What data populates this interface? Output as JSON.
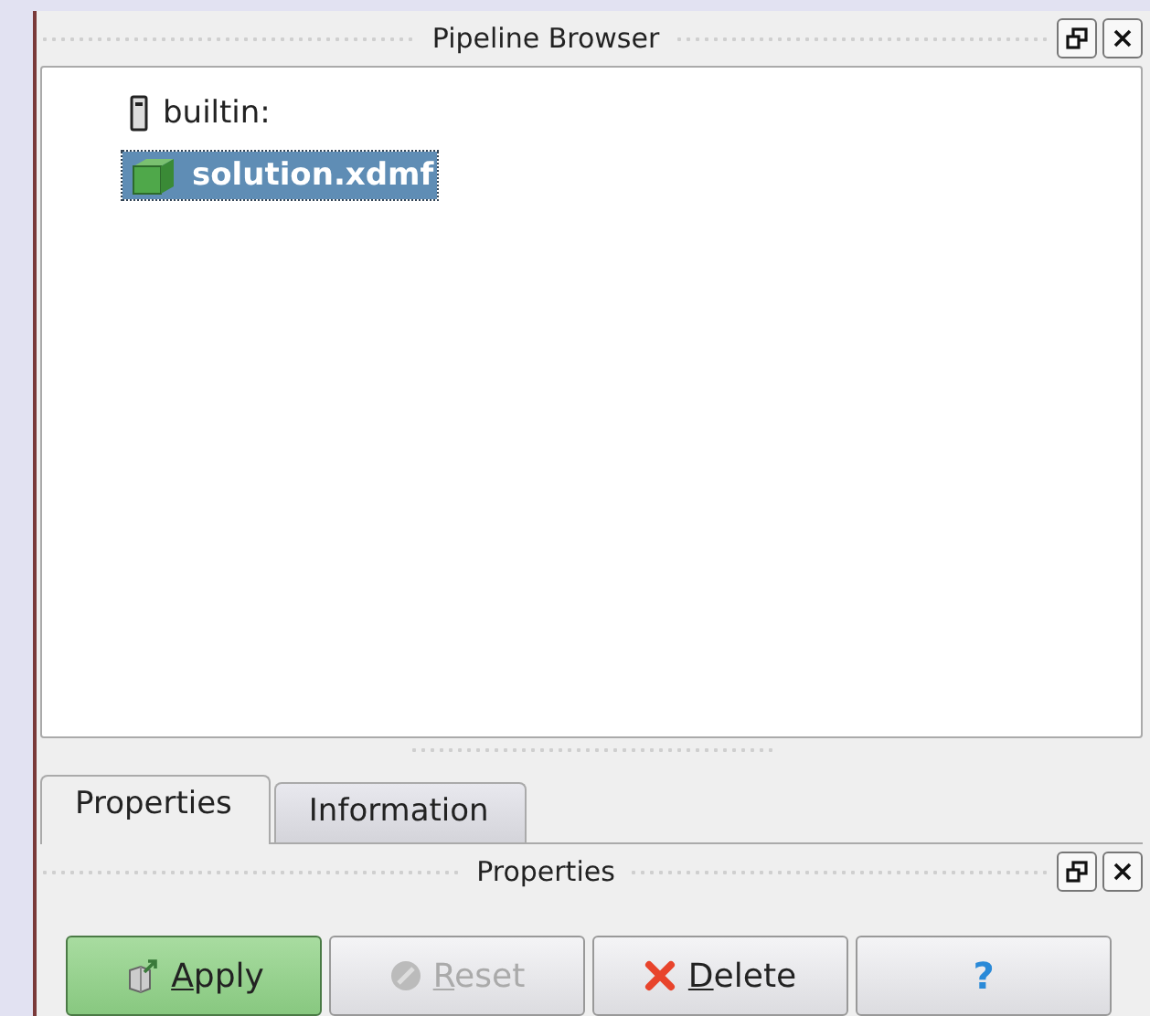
{
  "pipeline_browser": {
    "title": "Pipeline Browser",
    "tree": [
      {
        "label": "builtin:",
        "kind": "server",
        "selected": false,
        "children": [
          {
            "label": "solution.xdmf",
            "kind": "source",
            "selected": true
          }
        ]
      }
    ]
  },
  "tabs": [
    {
      "label": "Properties",
      "selected": true
    },
    {
      "label": "Information",
      "selected": false
    }
  ],
  "properties_panel": {
    "title": "Properties",
    "buttons": [
      {
        "label": "Apply",
        "kind": "apply",
        "highlighted": true,
        "disabled": false
      },
      {
        "label": "Reset",
        "kind": "reset",
        "highlighted": false,
        "disabled": true
      },
      {
        "label": "Delete",
        "kind": "delete",
        "highlighted": false,
        "disabled": false
      },
      {
        "label": "?",
        "kind": "help",
        "highlighted": false,
        "disabled": false
      }
    ]
  }
}
